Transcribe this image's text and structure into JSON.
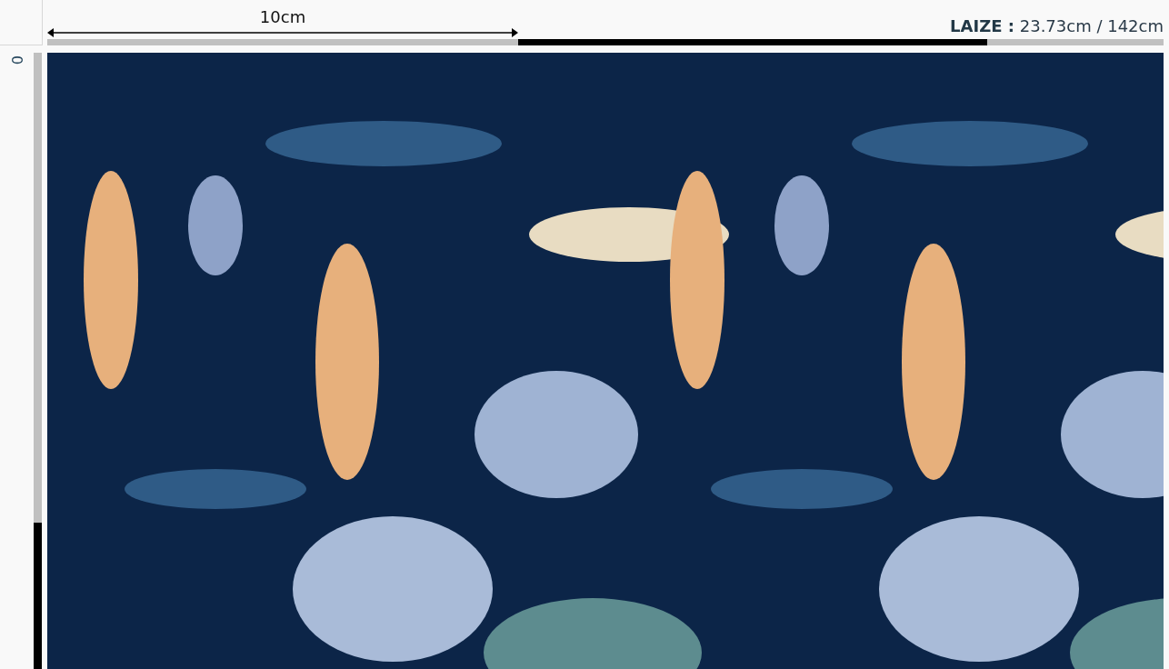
{
  "top_ruler": {
    "measure_label": "10cm",
    "width_label": "LAIZE :",
    "width_value": "23.73cm / 142cm"
  },
  "left_ruler": {
    "origin_label": "0"
  },
  "preview": {
    "kind": "pattern"
  }
}
